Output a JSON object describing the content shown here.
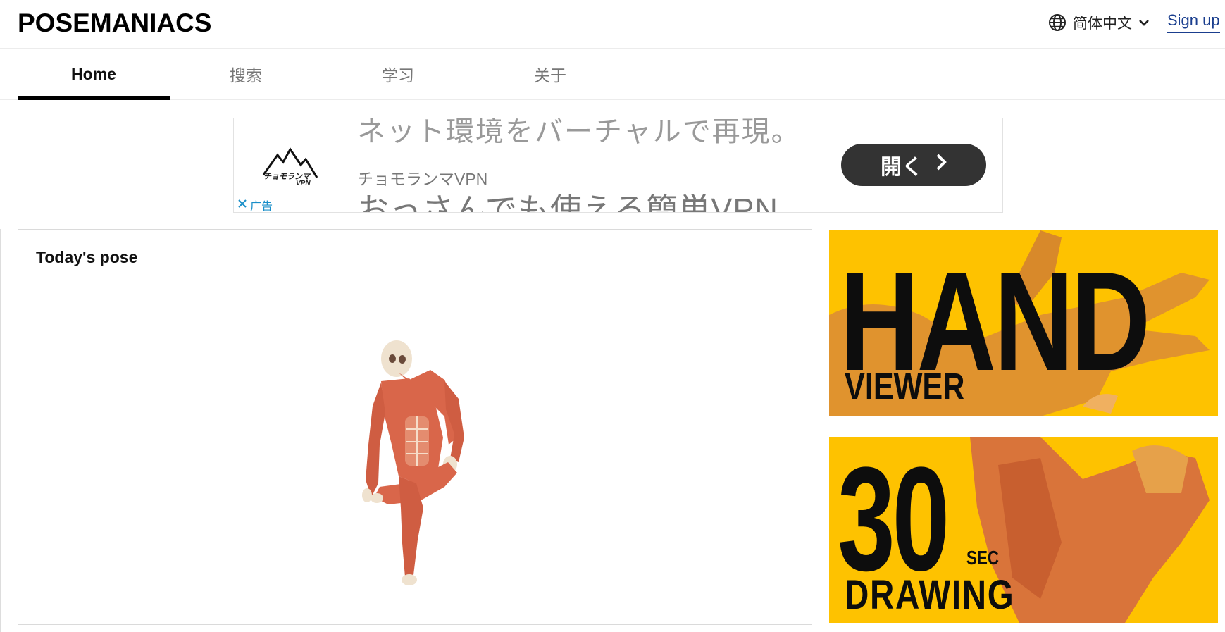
{
  "header": {
    "logo": "POSEMANIACS",
    "language": "简体中文",
    "signup": "Sign up"
  },
  "tabs": [
    {
      "label": "Home",
      "active": true
    },
    {
      "label": "搜索",
      "active": false
    },
    {
      "label": "学习",
      "active": false
    },
    {
      "label": "关于",
      "active": false
    }
  ],
  "ad": {
    "headline_top": "ネット環境をバーチャルで再現。",
    "brand": "チョモランマVPN",
    "headline_bottom": "おっさんでも使える簡単VPN",
    "button_label": "開く",
    "close_label": "广告",
    "logo_text": "チョモランマ",
    "logo_sub": "VPN"
  },
  "pose_card": {
    "title": "Today's pose"
  },
  "banners": {
    "hand": {
      "title": "HAND",
      "subtitle": "VIEWER"
    },
    "thirty": {
      "number": "30",
      "unit": "SEC",
      "subtitle": "DRAWING"
    }
  },
  "colors": {
    "banner_bg": "#fec200",
    "muscle": "#d9664a",
    "link": "#1a3e8e",
    "ad_close": "#1a8fc9"
  }
}
